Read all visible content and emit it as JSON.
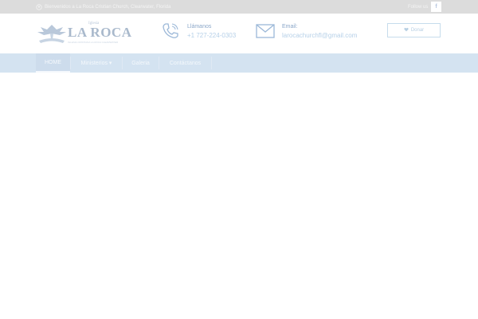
{
  "topbar": {
    "address_icon": "location-pin-icon",
    "address": "Bienvenidos a La Roca Cristian Church, Clearwater, Florida",
    "follow_label": "Follow us",
    "facebook_icon": "facebook-icon",
    "facebook_glyph": "f"
  },
  "logo": {
    "small_text": "Iglesia",
    "name": "LA ROCA",
    "tagline": "IGLESIA CRISTIANA LA ROCA CLEARWATER",
    "icon": "dove-icon"
  },
  "contacts": {
    "phone": {
      "icon": "phone-icon",
      "label": "Llámanos",
      "value": "+1 727-224-0303"
    },
    "email": {
      "icon": "envelope-icon",
      "label": "Email:",
      "value": "larocachurchfl@gmail.com"
    }
  },
  "donate_button": {
    "icon": "heart-icon",
    "label": "Donar"
  },
  "nav": {
    "items": [
      {
        "label": "HOME"
      },
      {
        "label": "Ministerios ▾"
      },
      {
        "label": "Galeria"
      },
      {
        "label": "Contáctanos"
      }
    ]
  },
  "colors": {
    "topbar_bg": "#dcdcdc",
    "navbar_bg": "#d4e3f1",
    "accent": "#8aa6c8"
  }
}
